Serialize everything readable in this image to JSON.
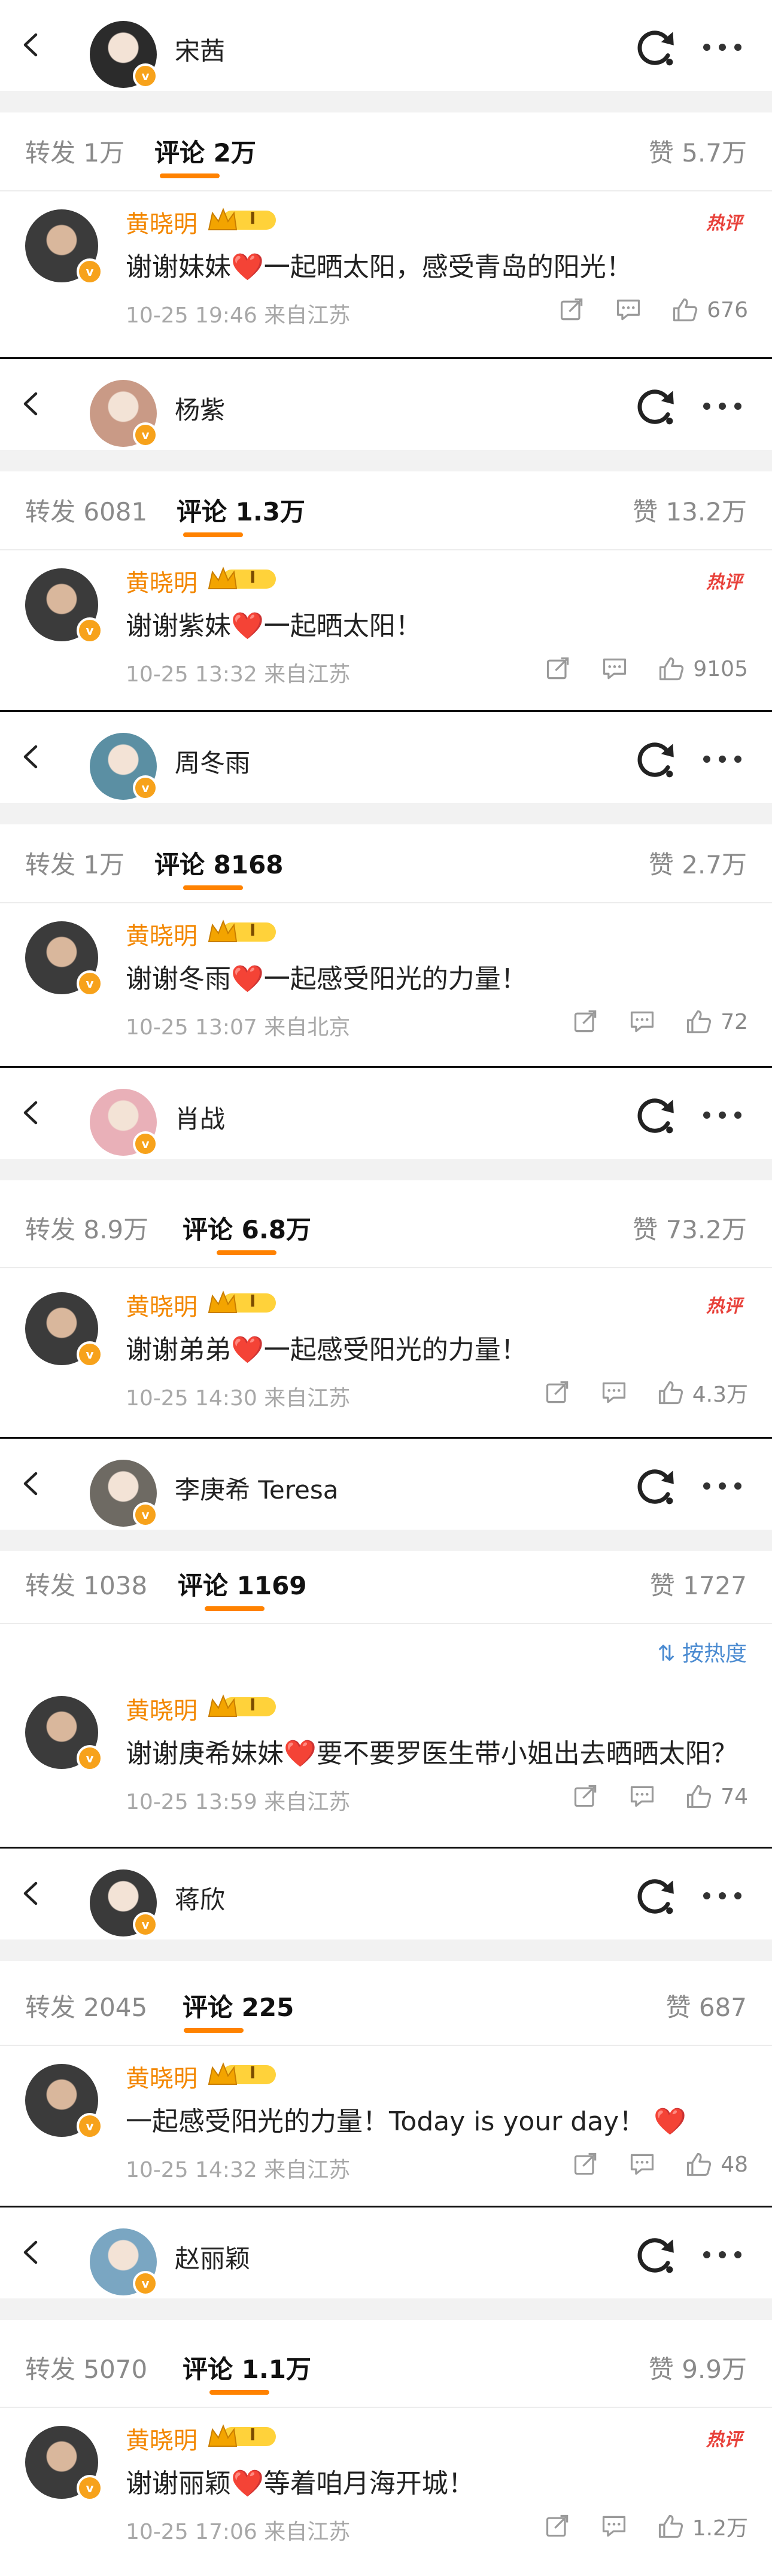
{
  "commenter": {
    "name": "黄晓明",
    "level": "I",
    "hot_tag": "热评"
  },
  "sort_label": "按热度",
  "sections": [
    {
      "poster": "宋茜",
      "avatar_color": "#2b2b2b",
      "tabs": {
        "repost": "转发 1万",
        "comment": "评论 2万",
        "likes": "赞 5.7万"
      },
      "comment": {
        "text": "谢谢妹妹❤️一起晒太阳，感受青岛的阳光！",
        "meta": "10-25 19:46  来自江苏",
        "likes": "676",
        "hot": true
      }
    },
    {
      "poster": "杨紫",
      "avatar_color": "#c99a86",
      "tabs": {
        "repost": "转发 6081",
        "comment": "评论 1.3万",
        "likes": "赞 13.2万"
      },
      "comment": {
        "text": "谢谢紫妹❤️一起晒太阳！",
        "meta": "10-25 13:32  来自江苏",
        "likes": "9105",
        "hot": true
      }
    },
    {
      "poster": "周冬雨",
      "avatar_color": "#5b8fa3",
      "tabs": {
        "repost": "转发 1万",
        "comment": "评论 8168",
        "likes": "赞 2.7万"
      },
      "comment": {
        "text": "谢谢冬雨❤️一起感受阳光的力量！",
        "meta": "10-25 13:07  来自北京",
        "likes": "72",
        "hot": false
      }
    },
    {
      "poster": "肖战",
      "avatar_color": "#e9b0b8",
      "tabs": {
        "repost": "转发 8.9万",
        "comment": "评论 6.8万",
        "likes": "赞 73.2万"
      },
      "comment": {
        "text": "谢谢弟弟❤️一起感受阳光的力量！",
        "meta": "10-25 14:30  来自江苏",
        "likes": "4.3万",
        "hot": true
      }
    },
    {
      "poster": "李庚希 Teresa",
      "avatar_color": "#6e6a63",
      "tabs": {
        "repost": "转发 1038",
        "comment": "评论 1169",
        "likes": "赞 1727"
      },
      "comment": {
        "text": "谢谢庚希妹妹❤️要不要罗医生带小姐出去晒晒太阳？",
        "meta": "10-25 13:59  来自江苏",
        "likes": "74",
        "hot": false
      }
    },
    {
      "poster": "蒋欣",
      "avatar_color": "#3a3a3a",
      "tabs": {
        "repost": "转发 2045",
        "comment": "评论 225",
        "likes": "赞 687"
      },
      "comment": {
        "text": "一起感受阳光的力量！Today is your day！ ❤️",
        "meta": "10-25 14:32  来自江苏",
        "likes": "48",
        "hot": false
      }
    },
    {
      "poster": "赵丽颖",
      "avatar_color": "#7aa6c2",
      "tabs": {
        "repost": "转发 5070",
        "comment": "评论 1.1万",
        "likes": "赞 9.9万"
      },
      "comment": {
        "text": "谢谢丽颖❤️等着咱月海开城！",
        "meta": "10-25 17:06  来自江苏",
        "likes": "1.2万",
        "hot": true
      }
    }
  ]
}
